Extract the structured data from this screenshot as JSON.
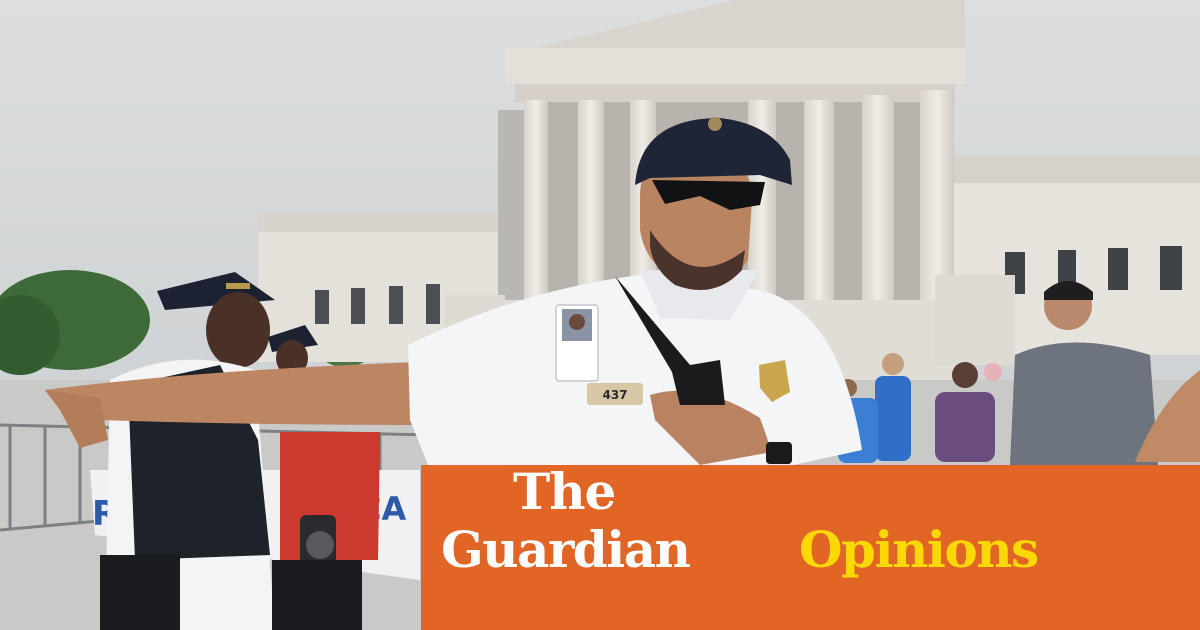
{
  "photo": {
    "badge_number": "437",
    "banner_text_left": "R",
    "banner_text_mid": "CA",
    "colors": {
      "sky": "#d7d9db",
      "building": "#e6e2dc",
      "uniform": "#f3f4f6",
      "cap": "#1e2536",
      "skin": "#b07a5a",
      "protester_red": "#c8342c"
    }
  },
  "brand": {
    "word_the": "The",
    "word_guardian": "Guardian",
    "word_section": "Opinions",
    "panel_color": "#e2611e",
    "section_color": "#ffd900",
    "text_color": "#ffffff"
  }
}
